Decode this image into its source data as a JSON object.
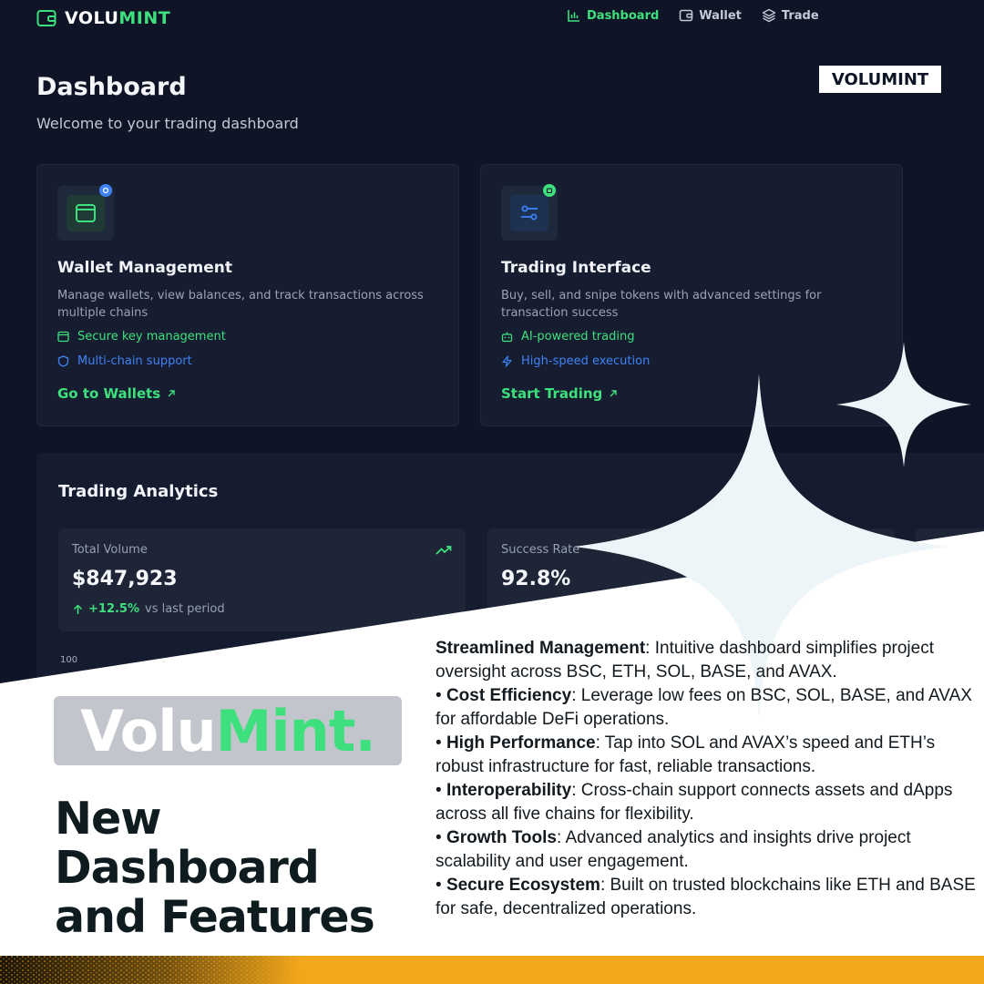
{
  "app": {
    "logo_text_a": "VOLU",
    "logo_text_b": "MINT",
    "brand_badge": "VOLUMINT"
  },
  "nav": {
    "items": [
      {
        "label": "Dashboard",
        "icon": "bar-chart-icon",
        "active": true
      },
      {
        "label": "Wallet",
        "icon": "wallet-icon",
        "active": false
      },
      {
        "label": "Trade",
        "icon": "layers-icon",
        "active": false
      }
    ]
  },
  "header": {
    "title": "Dashboard",
    "subtitle": "Welcome to your trading dashboard"
  },
  "cards": [
    {
      "title": "Wallet Management",
      "description": "Manage wallets, view balances, and track transactions across multiple chains",
      "features": [
        {
          "label": "Secure key management",
          "icon": "key-card-icon",
          "color": "#3ee07d"
        },
        {
          "label": "Multi-chain support",
          "icon": "shield-icon",
          "color": "#3f82f5"
        }
      ],
      "link": "Go to Wallets"
    },
    {
      "title": "Trading Interface",
      "description": "Buy, sell, and snipe tokens with advanced settings for transaction success",
      "features": [
        {
          "label": "AI-powered trading",
          "icon": "robot-icon",
          "color": "#3ee07d"
        },
        {
          "label": "High-speed execution",
          "icon": "lightning-icon",
          "color": "#3f82f5"
        }
      ],
      "link": "Start Trading"
    }
  ],
  "analytics": {
    "title": "Trading Analytics",
    "stats": [
      {
        "label": "Total Volume",
        "value": "$847,923",
        "change": "+12.5%",
        "period": "vs last period"
      },
      {
        "label": "Success Rate",
        "value": "92.8%"
      }
    ],
    "y_axis_tick": "100"
  },
  "promo": {
    "banner_a": "Volu",
    "banner_b": "Mint.",
    "headline_line1": "New Dashboard",
    "headline_line2": "and Features",
    "bullets": [
      {
        "prefix": "",
        "bold": "Streamlined Management",
        "text": ": Intuitive dashboard simplifies project oversight across BSC, ETH, SOL, BASE, and AVAX."
      },
      {
        "prefix": "• ",
        "bold": "Cost Efficiency",
        "text": ": Leverage low fees on BSC, SOL, BASE, and AVAX for affordable DeFi operations."
      },
      {
        "prefix": "• ",
        "bold": "High Performance",
        "text": ": Tap into SOL and AVAX’s speed and ETH’s robust infrastructure for fast, reliable transactions."
      },
      {
        "prefix": "• ",
        "bold": "Interoperability",
        "text": ": Cross-chain support connects assets and dApps across all five chains for flexibility."
      },
      {
        "prefix": "• ",
        "bold": "Growth Tools",
        "text": ": Advanced analytics and insights drive project scalability and user engagement."
      },
      {
        "prefix": "• ",
        "bold": "Secure Ecosystem",
        "text": ": Built on trusted blockchains like ETH and BASE for safe, decentralized operations."
      }
    ]
  },
  "colors": {
    "accent_green": "#3ee07d",
    "accent_blue": "#3f82f5",
    "background": "#0f1526",
    "bottom_bar": "#f2a71b"
  }
}
